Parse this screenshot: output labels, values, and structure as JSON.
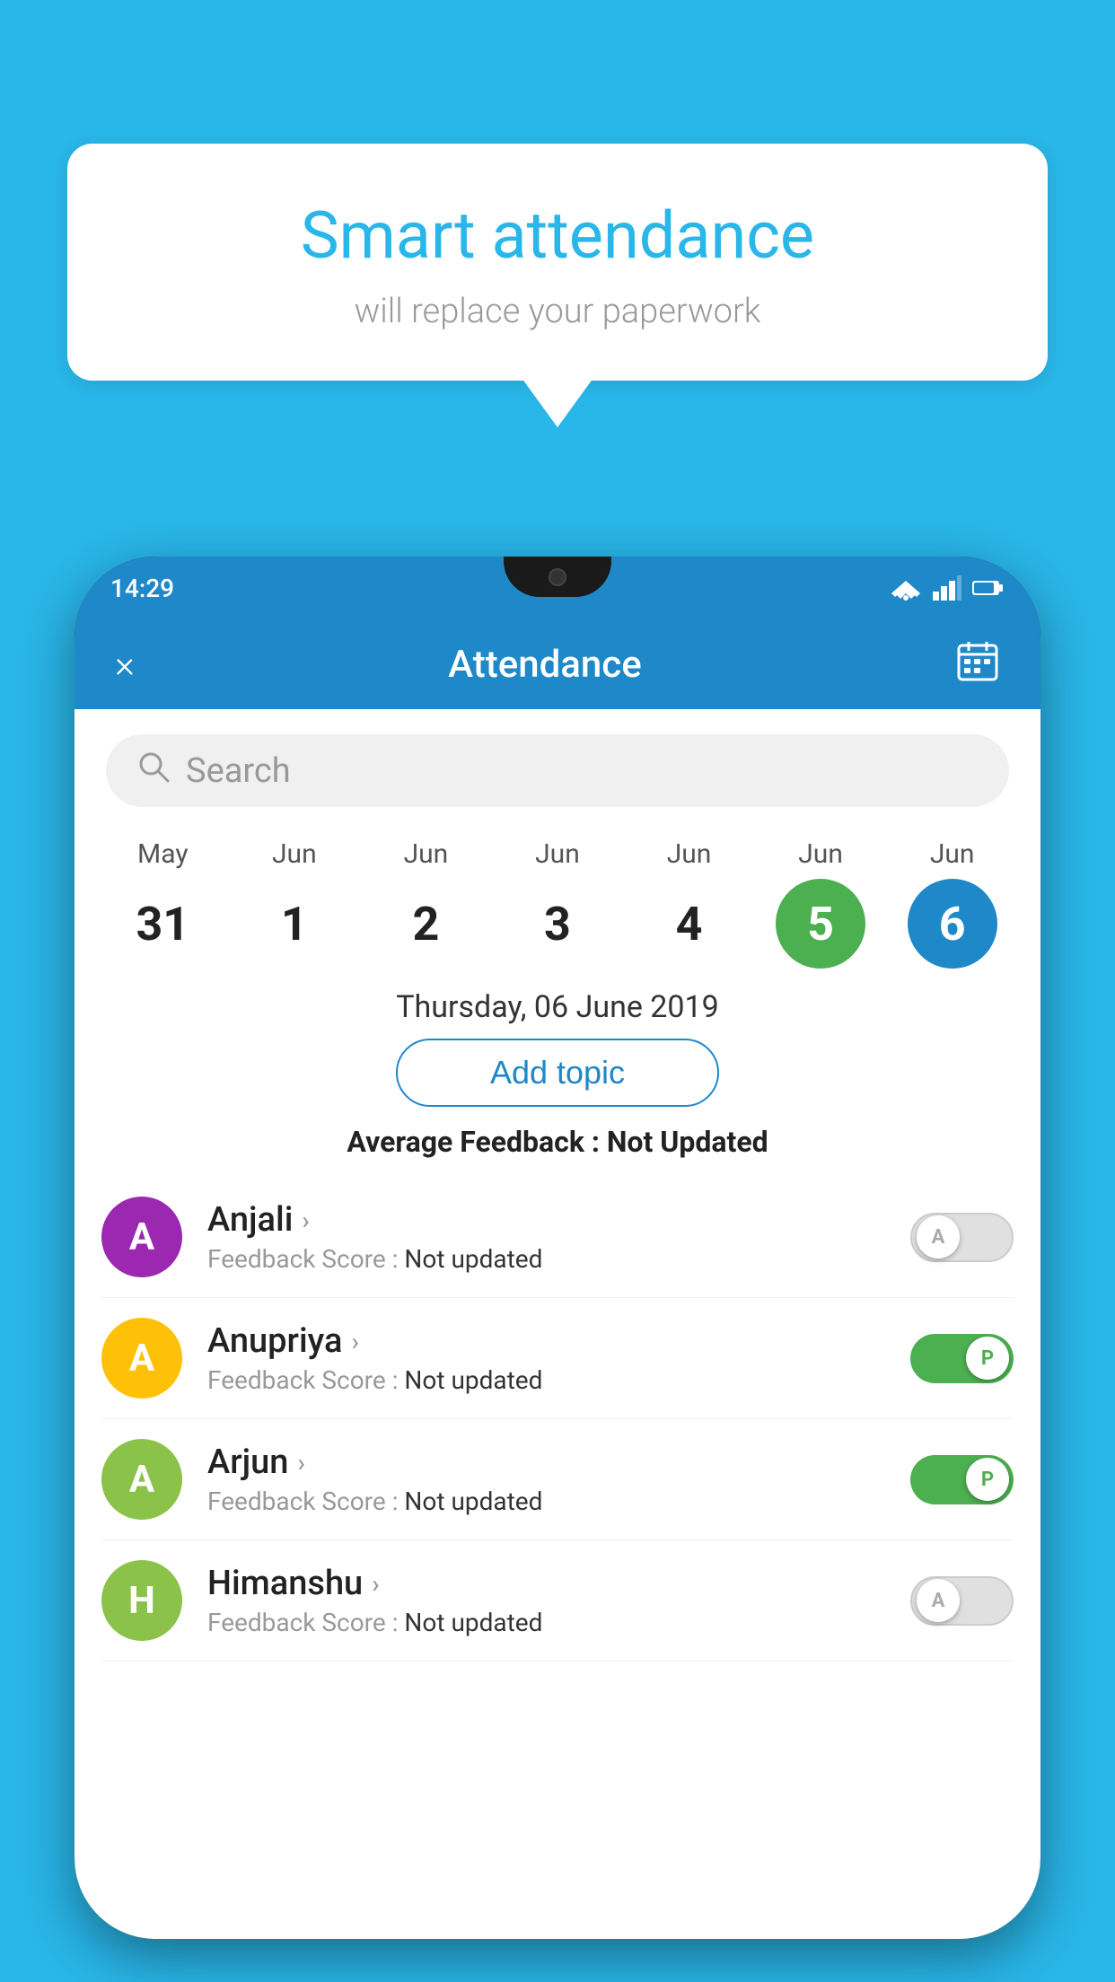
{
  "background_color": "#29b6e8",
  "speech_bubble": {
    "title": "Smart attendance",
    "subtitle": "will replace your paperwork"
  },
  "phone": {
    "status_bar": {
      "time": "14:29"
    },
    "header": {
      "close_label": "×",
      "title": "Attendance",
      "calendar_icon": "calendar"
    },
    "search": {
      "placeholder": "Search"
    },
    "calendar": {
      "columns": [
        {
          "month": "May",
          "day": "31",
          "state": "normal"
        },
        {
          "month": "Jun",
          "day": "1",
          "state": "normal"
        },
        {
          "month": "Jun",
          "day": "2",
          "state": "normal"
        },
        {
          "month": "Jun",
          "day": "3",
          "state": "normal"
        },
        {
          "month": "Jun",
          "day": "4",
          "state": "normal"
        },
        {
          "month": "Jun",
          "day": "5",
          "state": "today"
        },
        {
          "month": "Jun",
          "day": "6",
          "state": "selected"
        }
      ]
    },
    "selected_date": "Thursday, 06 June 2019",
    "add_topic_label": "Add topic",
    "avg_feedback_label": "Average Feedback :",
    "avg_feedback_value": "Not Updated",
    "students": [
      {
        "name": "Anjali",
        "avatar_letter": "A",
        "avatar_color": "#9c27b0",
        "feedback_label": "Feedback Score :",
        "feedback_value": "Not updated",
        "toggle_state": "off",
        "toggle_letter": "A"
      },
      {
        "name": "Anupriya",
        "avatar_letter": "A",
        "avatar_color": "#ffc107",
        "feedback_label": "Feedback Score :",
        "feedback_value": "Not updated",
        "toggle_state": "on",
        "toggle_letter": "P"
      },
      {
        "name": "Arjun",
        "avatar_letter": "A",
        "avatar_color": "#8bc34a",
        "feedback_label": "Feedback Score :",
        "feedback_value": "Not updated",
        "toggle_state": "on",
        "toggle_letter": "P"
      },
      {
        "name": "Himanshu",
        "avatar_letter": "H",
        "avatar_color": "#8bc34a",
        "feedback_label": "Feedback Score :",
        "feedback_value": "Not updated",
        "toggle_state": "off",
        "toggle_letter": "A"
      }
    ]
  }
}
